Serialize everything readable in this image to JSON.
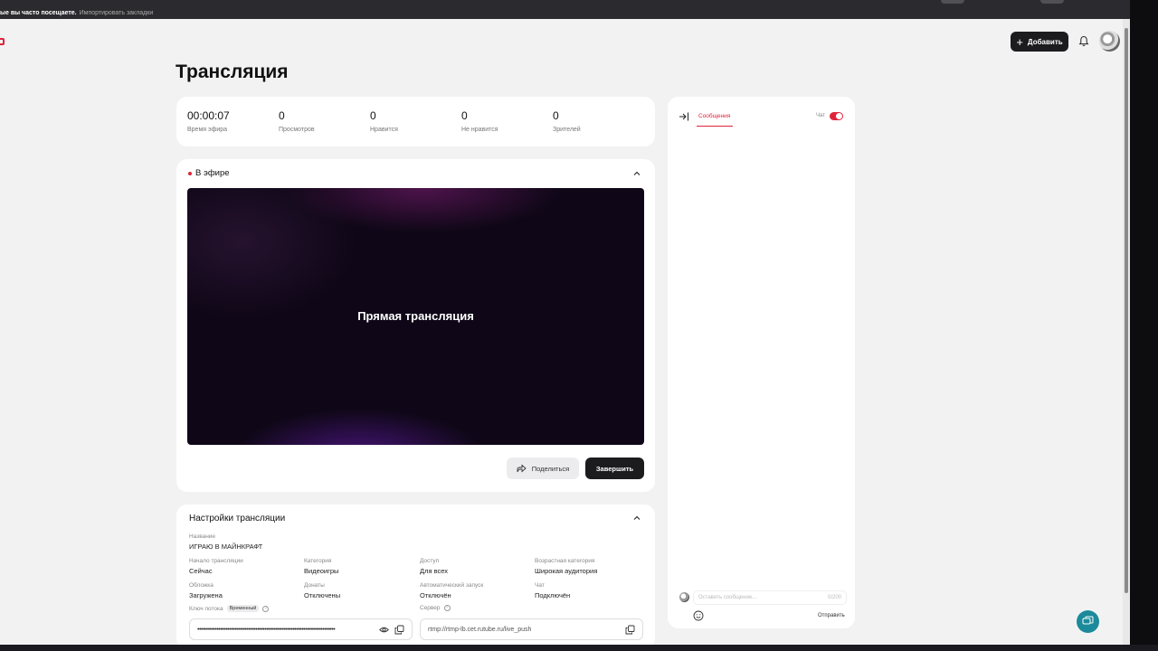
{
  "browser": {
    "bookmark_1": "ые вы часто посещаете.",
    "bookmark_2": "Импортировать закладки"
  },
  "header": {
    "add_label": "Добавить"
  },
  "page": {
    "title": "Трансляция"
  },
  "stats": [
    {
      "value": "00:00:07",
      "label": "Время эфира"
    },
    {
      "value": "0",
      "label": "Просмотров"
    },
    {
      "value": "0",
      "label": "Нравится"
    },
    {
      "value": "0",
      "label": "Не нравится"
    },
    {
      "value": "0",
      "label": "Зрителей"
    }
  ],
  "live": {
    "status": "В эфире",
    "caption": "Прямая трансляция",
    "share_label": "Поделиться",
    "finish_label": "Завершить"
  },
  "settings": {
    "title": "Настройки трансляции",
    "name_label": "Название",
    "name_value": "ИГРАЮ В МАЙНКРАФТ",
    "fields": [
      {
        "label": "Начало трансляции",
        "value": "Сейчас"
      },
      {
        "label": "Категория",
        "value": "Видеоигры"
      },
      {
        "label": "Доступ",
        "value": "Для всех"
      },
      {
        "label": "Возрастная категория",
        "value": "Широкая аудитория"
      },
      {
        "label": "Обложка",
        "value": "Загружена"
      },
      {
        "label": "Донаты",
        "value": "Отключены"
      },
      {
        "label": "Автоматический запуск",
        "value": "Отключён"
      },
      {
        "label": "Чат",
        "value": "Подключён"
      }
    ],
    "key_label": "Ключ потока",
    "key_tag": "Временный",
    "key_masked": "••••••••••••••••••••••••••••••••••••••••••••••••••••••••••••••••••••••••••••••",
    "server_label": "Сервер",
    "server_value": "rtmp://rtmp-lb.cet.rutube.ru/live_push"
  },
  "chat": {
    "tab_label": "Сообщения",
    "toggle_label": "Чат",
    "toggle_on": true,
    "input_placeholder": "Оставить сообщение...",
    "counter": "0/200",
    "send_label": "Отправить"
  },
  "colors": {
    "accent": "#e0233b",
    "dark_button": "#1c1c1f",
    "support": "#1b8a9b"
  }
}
